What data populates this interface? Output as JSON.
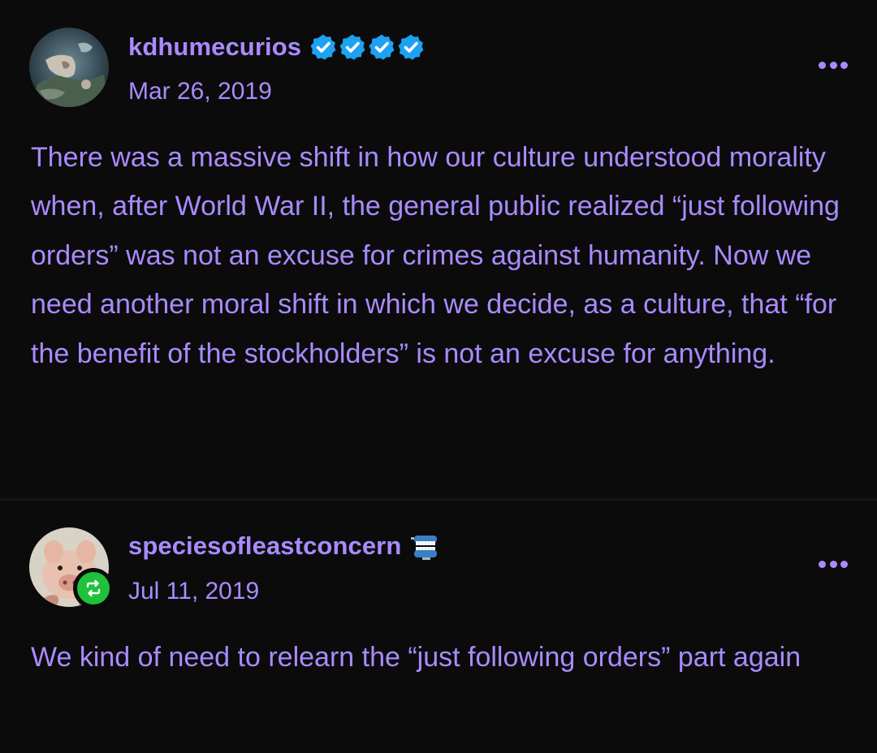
{
  "posts": [
    {
      "username": "kdhumecurios",
      "date": "Mar 26, 2019",
      "badges": [
        "verified-badge-icon",
        "verified-badge-icon",
        "verified-badge-icon",
        "verified-badge-icon"
      ],
      "body": "There was a massive shift in how our culture understood morality when, after World War II, the general public realized “just following orders” was not an excuse for crimes against humanity. Now we need another moral shift in which we decide, as a culture, that “for the benefit of the stockholders” is not an excuse for anything."
    },
    {
      "username": "speciesofleastconcern",
      "date": "Jul 11, 2019",
      "badges": [
        "chattering-teeth-icon"
      ],
      "reblog_icon": "reblog-icon",
      "body": "We kind of need to relearn the “just following orders” part again"
    }
  ],
  "colors": {
    "background": "#0b0b0c",
    "text": "#a98bff",
    "verified": "#1da1f2",
    "reblog": "#1fc23a"
  }
}
